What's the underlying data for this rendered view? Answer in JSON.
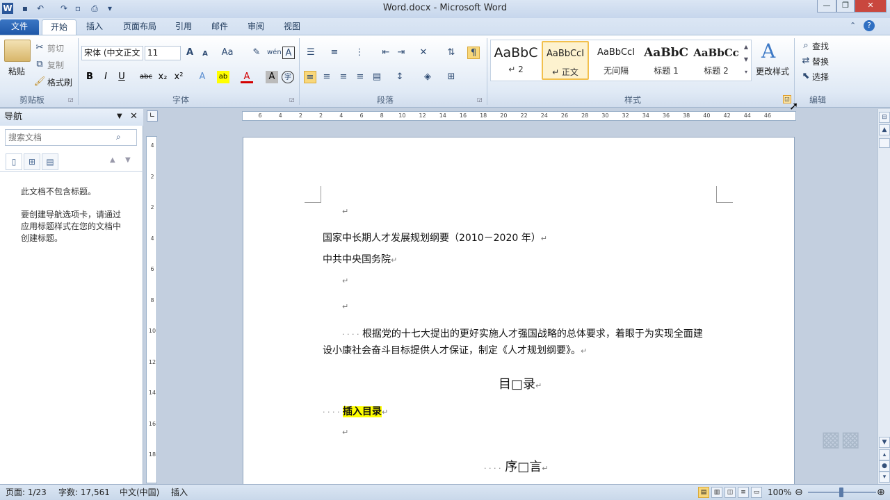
{
  "window": {
    "title": "Word.docx  -  Microsoft Word"
  },
  "ribbon_tabs": [
    "文件",
    "开始",
    "插入",
    "页面布局",
    "引用",
    "邮件",
    "审阅",
    "视图"
  ],
  "clipboard": {
    "paste": "粘贴",
    "cut": "剪切",
    "copy": "复制",
    "format_painter": "格式刷",
    "group": "剪贴板"
  },
  "font": {
    "name": "宋体 (中文正文",
    "size": "11",
    "group": "字体"
  },
  "paragraph": {
    "group": "段落"
  },
  "styles": {
    "group": "样式",
    "items": [
      {
        "preview": "AaBbC",
        "name": "↵ 2"
      },
      {
        "preview": "AaBbCcI",
        "name": "↵ 正文"
      },
      {
        "preview": "AaBbCcI",
        "name": "无间隔"
      },
      {
        "preview": "AaBbC",
        "name": "标题 1"
      },
      {
        "preview": "AaBbCc",
        "name": "标题 2"
      }
    ],
    "change_styles": "更改样式"
  },
  "editing": {
    "find": "查找",
    "replace": "替换",
    "select": "选择",
    "group": "编辑"
  },
  "nav": {
    "title": "导航",
    "search_placeholder": "搜索文档",
    "msg1": "此文档不包含标题。",
    "msg2": "要创建导航选项卡，请通过应用标题样式在您的文档中创建标题。"
  },
  "ruler": {
    "h_ticks": [
      "6",
      "4",
      "2",
      "2",
      "4",
      "6",
      "8",
      "10",
      "12",
      "14",
      "16",
      "18",
      "20",
      "22",
      "24",
      "26",
      "28",
      "30",
      "32",
      "34",
      "36",
      "38",
      "40",
      "42",
      "44",
      "46"
    ],
    "v_ticks": [
      "4",
      "2",
      "2",
      "4",
      "6",
      "8",
      "10",
      "12",
      "14",
      "16",
      "18"
    ]
  },
  "document": {
    "line1": "国家中长期人才发展规划纲要（2010－2020 年）",
    "line2": "中共中央国务院",
    "para1a": "根据党的十七大提出的更好实施人才强国战略的总体要求，着眼于为实现全面建",
    "para1b": "设小康社会奋斗目标提供人才保证，制定《人才规划纲要》。",
    "toc_title": "目□录",
    "toc_insert": "插入目录",
    "preface": "序□言",
    "para_mark": "↵",
    "dots": "· · · ·"
  },
  "status": {
    "page": "页面: 1/23",
    "words": "字数: 17,561",
    "lang": "中文(中国)",
    "mode": "插入",
    "zoom": "100%"
  },
  "colors": {
    "file_tab": "#1f58a8",
    "highlight": "#ffff00",
    "font_color": "#d40000"
  }
}
